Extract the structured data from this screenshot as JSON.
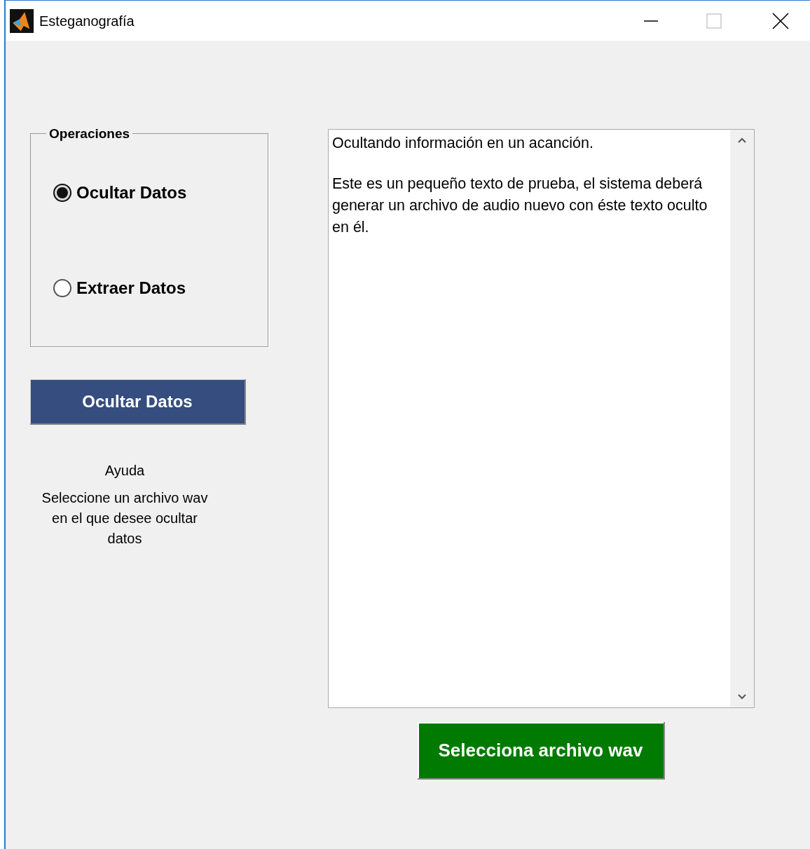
{
  "window": {
    "title": "Esteganografía"
  },
  "operations": {
    "title": "Operaciones",
    "options": [
      {
        "label": "Ocultar Datos",
        "selected": true
      },
      {
        "label": "Extraer Datos",
        "selected": false
      }
    ]
  },
  "action_button": {
    "label": "Ocultar Datos"
  },
  "help": {
    "title": "Ayuda",
    "text": "Seleccione un archivo wav en el que desee ocultar datos"
  },
  "message_box": {
    "paragraphs": [
      "Ocultando información en un acanción.",
      "Este es un pequeño texto de prueba, el sistema deberá generar un archivo de audio nuevo con éste texto oculto en él."
    ]
  },
  "select_button": {
    "label": "Selecciona archivo wav"
  }
}
